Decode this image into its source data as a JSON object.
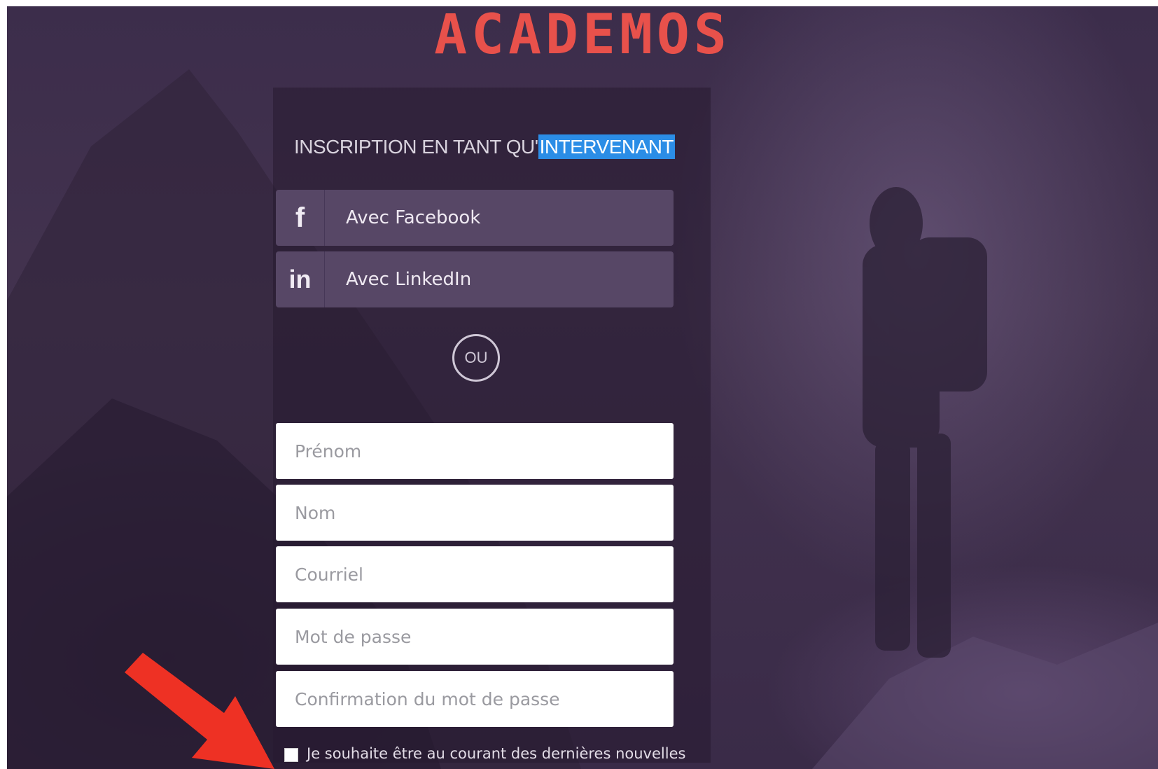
{
  "logo": {
    "text": "ACADEMOS",
    "color": "#e8514b"
  },
  "signup": {
    "title_prefix": "INSCRIPTION EN TANT QU'",
    "title_highlight": "INTERVENANT",
    "highlight_color": "#2b8de6"
  },
  "social": {
    "facebook": {
      "icon": "f",
      "label": "Avec Facebook"
    },
    "linkedin": {
      "icon": "in",
      "label": "Avec LinkedIn"
    }
  },
  "divider": {
    "label": "OU"
  },
  "form": {
    "first_name_placeholder": "Prénom",
    "last_name_placeholder": "Nom",
    "email_placeholder": "Courriel",
    "password_placeholder": "Mot de passe",
    "confirm_password_placeholder": "Confirmation du mot de passe",
    "newsletter_label": "Je souhaite être au courant des dernières nouvelles",
    "newsletter_checked": false
  },
  "annotation": {
    "arrow_color": "#ee3124"
  }
}
